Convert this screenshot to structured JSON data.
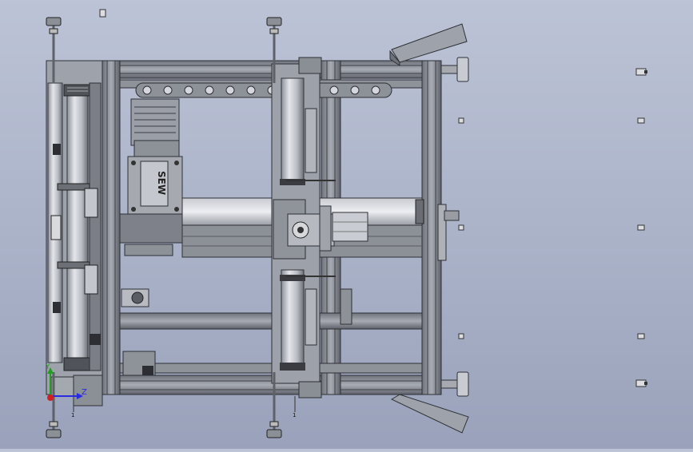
{
  "viewport": {
    "background_top": "#bcc3d6",
    "background_bottom": "#9aa2bb"
  },
  "model": {
    "motor_label": "SEW",
    "frame_color": "#7d8189",
    "roller_color": "#c9ccd3",
    "plate_color": "#8a8d94"
  },
  "triad": {
    "z_label": "Z",
    "y_label": "Y",
    "z_color": "#2a2ae0",
    "y_color": "#1fa01f",
    "x_color": "#d02020"
  },
  "callouts": {
    "left_number": "1",
    "mid_number": "1"
  }
}
